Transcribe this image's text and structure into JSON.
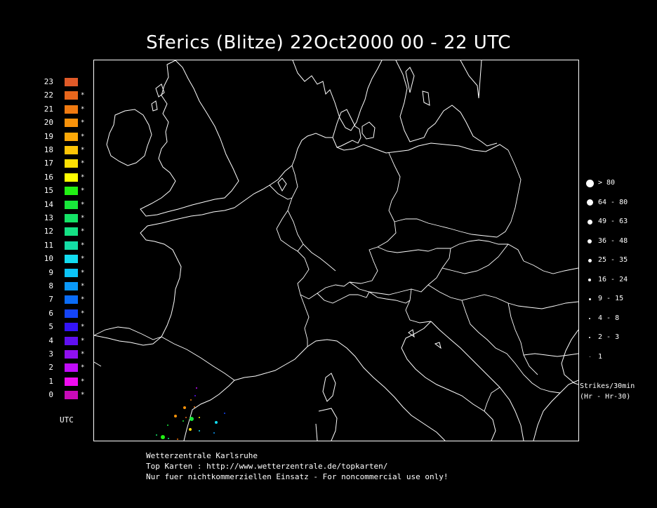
{
  "title": "Sferics (Blitze) 22Oct2000 00 - 22 UTC",
  "hour_legend": {
    "unit_label": "UTC",
    "items": [
      {
        "hour": "23",
        "color": "#e05a28",
        "marked": false
      },
      {
        "hour": "22",
        "color": "#e8661c",
        "marked": true
      },
      {
        "hour": "21",
        "color": "#f07a10",
        "marked": true
      },
      {
        "hour": "20",
        "color": "#f8920a",
        "marked": true
      },
      {
        "hour": "19",
        "color": "#fba808",
        "marked": true
      },
      {
        "hour": "18",
        "color": "#fcc406",
        "marked": true
      },
      {
        "hour": "17",
        "color": "#fde004",
        "marked": true
      },
      {
        "hour": "16",
        "color": "#fefe02",
        "marked": true
      },
      {
        "hour": "15",
        "color": "#22f014",
        "marked": true
      },
      {
        "hour": "14",
        "color": "#18e83a",
        "marked": true
      },
      {
        "hour": "13",
        "color": "#14e266",
        "marked": true
      },
      {
        "hour": "12",
        "color": "#14e084",
        "marked": true
      },
      {
        "hour": "11",
        "color": "#14dca6",
        "marked": true
      },
      {
        "hour": "10",
        "color": "#12dcf0",
        "marked": true
      },
      {
        "hour": "9",
        "color": "#0cc4f8",
        "marked": true
      },
      {
        "hour": "8",
        "color": "#0a98f8",
        "marked": true
      },
      {
        "hour": "7",
        "color": "#0a6cf8",
        "marked": true
      },
      {
        "hour": "6",
        "color": "#1444f8",
        "marked": true
      },
      {
        "hour": "5",
        "color": "#3414f8",
        "marked": true
      },
      {
        "hour": "4",
        "color": "#6010f0",
        "marked": true
      },
      {
        "hour": "3",
        "color": "#9010f0",
        "marked": true
      },
      {
        "hour": "2",
        "color": "#c00cf8",
        "marked": true
      },
      {
        "hour": "1",
        "color": "#f00cf0",
        "marked": true
      },
      {
        "hour": "0",
        "color": "#c80ab8",
        "marked": true
      }
    ],
    "mark_glyph": "*"
  },
  "size_legend": {
    "items": [
      {
        "label": "> 80"
      },
      {
        "label": "64 - 80"
      },
      {
        "label": "49 - 63"
      },
      {
        "label": "36 - 48"
      },
      {
        "label": "25 - 35"
      },
      {
        "label": "16 - 24"
      },
      {
        "label": "9 - 15"
      },
      {
        "label": "4 - 8"
      },
      {
        "label": "2 - 3"
      },
      {
        "label": "1"
      }
    ],
    "caption_line1": "Strikes/30min",
    "caption_line2": "(Hr - Hr-30)"
  },
  "footer": {
    "line1": "Wetterzentrale Karlsruhe",
    "line2": "Top Karten :  http://www.wetterzentrale.de/topkarten/",
    "line3": "Nur fuer nichtkommerziellen Einsatz - For noncommercial use only!"
  },
  "colors": {
    "background": "#000000",
    "coastline": "#ffffff"
  }
}
